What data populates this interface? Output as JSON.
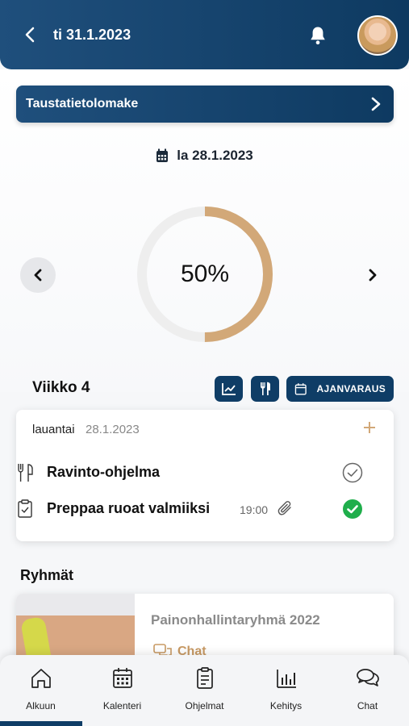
{
  "header": {
    "date": "ti 31.1.2023",
    "back_icon": "chevron-left-icon",
    "bell_icon": "bell-icon",
    "avatar": "user-avatar"
  },
  "banner": {
    "label": "Taustatietolomake",
    "icon": "chevron-right-icon"
  },
  "selected_day": {
    "label": "la 28.1.2023",
    "icon": "calendar-icon"
  },
  "progress": {
    "value": 50,
    "label": "50%",
    "color": "#d2a878",
    "track_color": "#eeeeee"
  },
  "week": {
    "title": "Viikko 4",
    "buttons": {
      "chart_icon": "chart-icon",
      "food_icon": "fork-knife-icon",
      "booking_label": "AJANVARAUS",
      "booking_icon": "calendar-icon"
    }
  },
  "day_card": {
    "day_name": "lauantai",
    "date": "28.1.2023",
    "add_icon": "plus-icon",
    "tasks": [
      {
        "icon": "fork-knife-icon",
        "label": "Ravinto-ohjelma",
        "time": "",
        "status": "pending"
      },
      {
        "icon": "clipboard-check-icon",
        "label": "Preppaa ruoat valmiiksi",
        "time": "19:00",
        "attachment": true,
        "status": "done"
      }
    ]
  },
  "groups": {
    "title": "Ryhmät",
    "items": [
      {
        "name": "Painonhallintaryhmä 2022",
        "chat_label": "Chat"
      }
    ]
  },
  "bottom_nav": {
    "active": "Alkuun",
    "tabs": [
      {
        "label": "Alkuun",
        "icon": "home-icon"
      },
      {
        "label": "Kalenteri",
        "icon": "calendar-icon"
      },
      {
        "label": "Ohjelmat",
        "icon": "clipboard-icon"
      },
      {
        "label": "Kehitys",
        "icon": "bar-chart-icon"
      },
      {
        "label": "Chat",
        "icon": "chat-icon"
      }
    ]
  },
  "colors": {
    "primary": "#0f3d66",
    "accent": "#d2a878",
    "success": "#1fae4b"
  }
}
